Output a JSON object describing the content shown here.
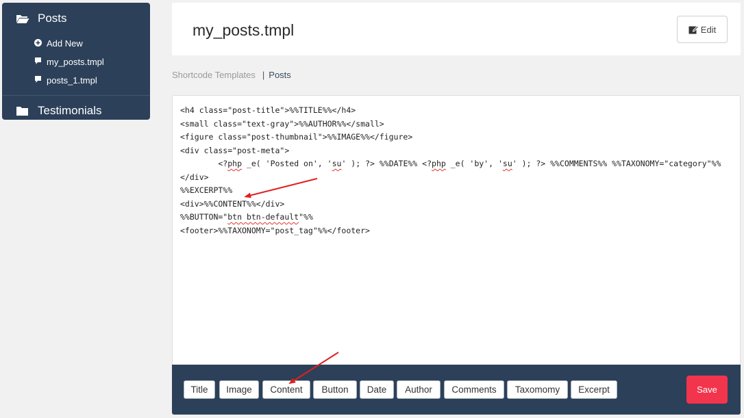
{
  "sidebar": {
    "folders": [
      {
        "label": "Posts",
        "icon": "folder-open-icon"
      },
      {
        "label": "Testimonials",
        "icon": "folder-icon"
      }
    ],
    "items": [
      {
        "label": "Add New",
        "icon": "plus-circle-icon"
      },
      {
        "label": "my_posts.tmpl",
        "icon": "file-icon"
      },
      {
        "label": "posts_1.tmpl",
        "icon": "file-icon"
      }
    ]
  },
  "header": {
    "title": "my_posts.tmpl",
    "edit_label": "Edit"
  },
  "breadcrumb": {
    "parent": "Shortcode Templates",
    "separator": "|",
    "current": "Posts"
  },
  "editor": {
    "lines": [
      "<h4 class=\"post-title\">%%TITLE%%</h4>",
      "<small class=\"text-gray\">%%AUTHOR%%</small>",
      "<figure class=\"post-thumbnail\">%%IMAGE%%</figure>",
      "<div class=\"post-meta\">",
      "        <?php _e( 'Posted on', 'su' ); ?> %%DATE%% <?php _e( 'by', 'su' ); ?> %%COMMENTS%% %%TAXONOMY=\"category\"%%",
      "</div>",
      "%%EXCERPT%%",
      "<div>%%CONTENT%%</div>",
      "%%BUTTON=\"btn btn-default\"%%",
      "<footer>%%TAXONOMY=\"post_tag\"%%</footer>"
    ]
  },
  "toolbar": {
    "buttons": [
      "Title",
      "Image",
      "Content",
      "Button",
      "Date",
      "Author",
      "Comments",
      "Taxomomy",
      "Excerpt"
    ],
    "save_label": "Save"
  },
  "colors": {
    "nav": "#2c4059",
    "save": "#f2344c",
    "arrow": "#e02020"
  }
}
